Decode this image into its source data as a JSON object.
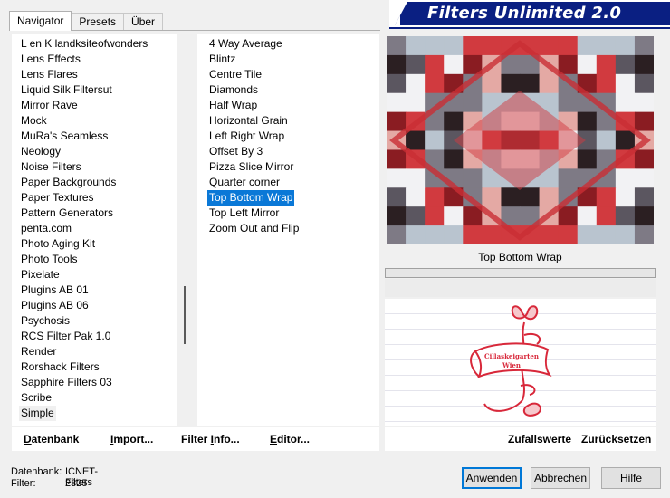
{
  "tabs": [
    "Navigator",
    "Presets",
    "Über"
  ],
  "banner_title": "Filters Unlimited 2.0",
  "categories": [
    "L en K landksiteofwonders",
    "Lens Effects",
    "Lens Flares",
    "Liquid Silk Filtersut",
    "Mirror Rave",
    "Mock",
    "MuRa's Seamless",
    "Neology",
    "Noise Filters",
    "Paper Backgrounds",
    "Paper Textures",
    "Pattern Generators",
    "penta.com",
    "Photo Aging Kit",
    "Photo Tools",
    "Pixelate",
    "Plugins AB 01",
    "Plugins AB 06",
    "Psychosis",
    "RCS Filter Pak 1.0",
    "Render",
    "Rorshack Filters",
    "Sapphire Filters 03",
    "Scribe",
    "Simple"
  ],
  "focused_category": "Simple",
  "filters": [
    "4 Way Average",
    "Blintz",
    "Centre Tile",
    "Diamonds",
    "Half Wrap",
    "Horizontal Grain",
    "Left Right Wrap",
    "Offset By 3",
    "Pizza Slice Mirror",
    "Quarter corner",
    "Top Bottom Wrap",
    "Top Left Mirror",
    "Zoom Out and Flip"
  ],
  "selected_filter": "Top Bottom Wrap",
  "preview_label": "Top Bottom Wrap",
  "logo_text": [
    "Cillaskeigarten",
    "Wien"
  ],
  "left_buttons": [
    {
      "name": "datenbank-button",
      "label": "Datenbank",
      "u": "D"
    },
    {
      "name": "import-button",
      "label": "Import...",
      "u": "I"
    },
    {
      "name": "filter-info-button",
      "label": "Filter Info...",
      "u": "I"
    },
    {
      "name": "editor-button",
      "label": "Editor...",
      "u": "E"
    }
  ],
  "right_buttons": [
    {
      "name": "zufallswerte-button",
      "label": "Zufallswerte"
    },
    {
      "name": "zuruecksetzen-button",
      "label": "Zurücksetzen"
    }
  ],
  "status": {
    "datenbank_label": "Datenbank:",
    "datenbank_value": "ICNET-Filters",
    "filter_label": "Filter:",
    "filter_value": "2325"
  },
  "dialog_buttons": {
    "apply": "Anwenden",
    "cancel": "Abbrechen",
    "help": "Hilfe"
  },
  "colors": {
    "banner": "#0a1f82",
    "selection": "#0a78d7",
    "logo_red": "#d8283a"
  }
}
